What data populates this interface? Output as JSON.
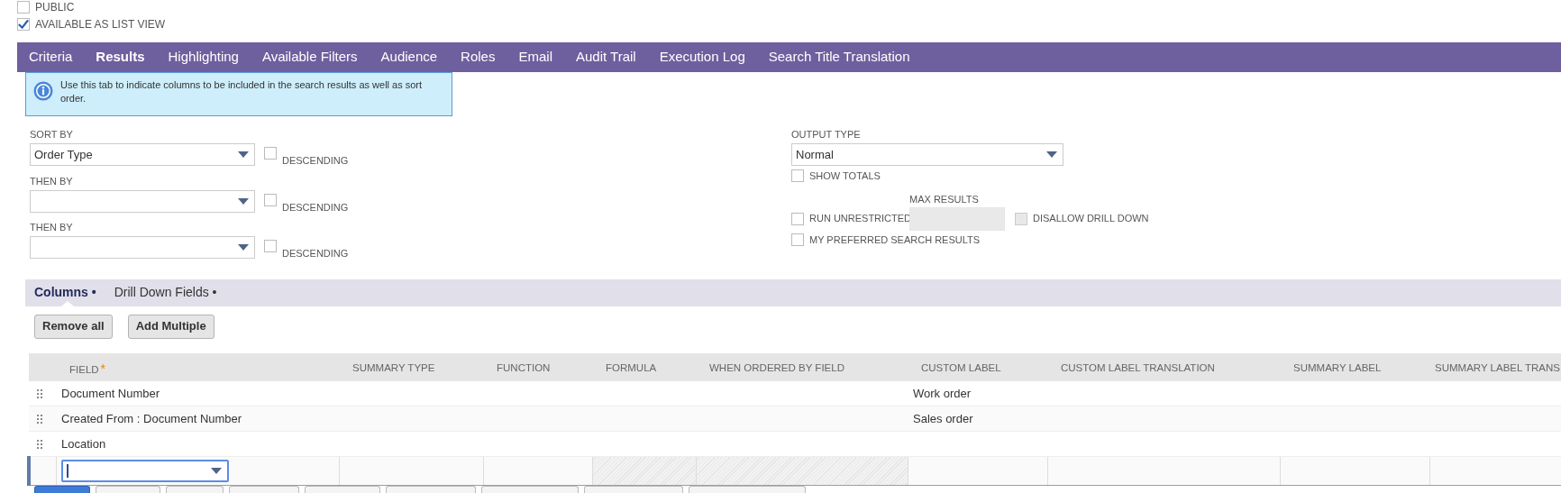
{
  "options": [
    {
      "label": "PUBLIC",
      "checked": false
    },
    {
      "label": "AVAILABLE AS LIST VIEW",
      "checked": true
    }
  ],
  "tabs": [
    {
      "label": "Criteria",
      "selected": false
    },
    {
      "label": "Results",
      "selected": true
    },
    {
      "label": "Highlighting",
      "selected": false
    },
    {
      "label": "Available Filters",
      "selected": false
    },
    {
      "label": "Audience",
      "selected": false
    },
    {
      "label": "Roles",
      "selected": false
    },
    {
      "label": "Email",
      "selected": false
    },
    {
      "label": "Audit Trail",
      "selected": false
    },
    {
      "label": "Execution Log",
      "selected": false
    },
    {
      "label": "Search Title Translation",
      "selected": false
    }
  ],
  "info_message": "Use this tab to indicate columns to be included in the search results as well as sort order.",
  "sort_fields": [
    {
      "label": "SORT BY",
      "value": "Order Type",
      "descending": {
        "label": "DESCENDING",
        "checked": false
      }
    },
    {
      "label": "THEN BY",
      "descending": {
        "label": "DESCENDING",
        "checked": false
      }
    },
    {
      "label": "THEN BY",
      "descending": {
        "label": "DESCENDING",
        "checked": false
      }
    }
  ],
  "output_type": {
    "label": "OUTPUT TYPE",
    "value": "Normal"
  },
  "show_totals": {
    "label": "SHOW TOTALS",
    "checked": false
  },
  "max_results": {
    "label": "MAX RESULTS",
    "disabled": true
  },
  "run_unrestricted": {
    "label": "RUN UNRESTRICTED",
    "checked": false
  },
  "disallow_drill_down": {
    "label": "DISALLOW DRILL DOWN",
    "checked": false,
    "disabled": true
  },
  "my_preferred_search_results": {
    "label": "MY PREFERRED SEARCH RESULTS",
    "checked": false
  },
  "subtabs": [
    {
      "label": "Columns •",
      "selected": true
    },
    {
      "label": "Drill Down Fields •",
      "selected": false
    }
  ],
  "buttons": [
    "Remove all",
    "Add Multiple"
  ],
  "table": {
    "columns": [
      {
        "label": "FIELD",
        "required_mark": "*"
      },
      {
        "label": "SUMMARY TYPE"
      },
      {
        "label": "FUNCTION"
      },
      {
        "label": "FORMULA"
      },
      {
        "label": "WHEN ORDERED BY FIELD"
      },
      {
        "label": "CUSTOM LABEL"
      },
      {
        "label": "CUSTOM LABEL TRANSLATION"
      },
      {
        "label": "SUMMARY LABEL"
      },
      {
        "label": "SUMMARY LABEL TRANS"
      }
    ],
    "rows": [
      {
        "field": "Document Number",
        "custom_label": "Work order"
      },
      {
        "field": "Created From : Document Number",
        "custom_label": "Sales order"
      },
      {
        "field": "Location"
      }
    ]
  }
}
